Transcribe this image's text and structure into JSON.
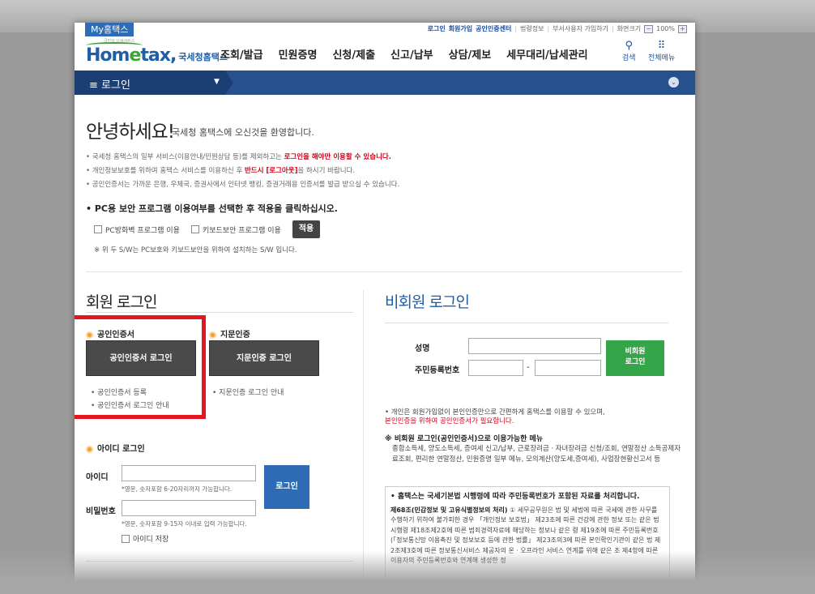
{
  "util": {
    "my_tab": "My홈택스",
    "links": [
      "로그인",
      "회원가입",
      "공인인증센터"
    ],
    "plain_links": [
      "법령정보",
      "부서사용자 가입하기",
      "화면크기"
    ],
    "zoom": "100%",
    "zoom_minus": "−",
    "zoom_plus": "+"
  },
  "header": {
    "logo_tiny": "국민의 납세서비스",
    "logo_ho": "Hom",
    "logo_e": "e",
    "logo_tax": "tax",
    "logo_comma": ",",
    "logo_sub": "국세청홈택스",
    "menu": [
      "조회/발급",
      "민원증명",
      "신청/제출",
      "신고/납부",
      "상담/제보",
      "세무대리/납세관리"
    ],
    "search_label": "검색",
    "allmenu_label": "전체메뉴"
  },
  "bar": {
    "label": "≡ 로그인",
    "caret": "▼",
    "circle": "⌄"
  },
  "greeting": {
    "title": "안녕하세요!",
    "sub": "국세청 홈택스에 오신것을 환영합니다.",
    "note1_a": "• 국세청 홈택스의 일부 서비스(이용안내/민원상담 등)를 제외하고는 ",
    "note1_b": "로그인을 해야만 이용할 수 있습니다.",
    "note2_a": "• 개인정보보호를 위하여 홈택스 서비스를 이용하신 후 ",
    "note2_b": "반드시 [로그아웃]",
    "note2_c": "을 하시기 바랍니다.",
    "note3": "• 공인인증서는 가까운 은행, 우체국, 증권사에서 인터넷 뱅킹, 증권거래용 인증서를 발급 받으실 수 있습니다."
  },
  "security": {
    "title": "• PC용 보안 프로그램 이용여부를 선택한 후 적용을 클릭하십시오.",
    "opt1": "PC방화벽 프로그램 이용",
    "opt2": "키보드보안 프로그램 이용",
    "apply": "적용",
    "note": "※ 위 두 S/W는 PC보호와 키보드보안을 위하여 설치하는 S/W 입니다."
  },
  "member": {
    "title": "회원 로그인",
    "cert_label": "공인인증서",
    "cert_button": "공인인증서 로그인",
    "cert_link1": "• 공인인증서 등록",
    "cert_link2": "• 공인인증서 로그인 안내",
    "finger_label": "지문인증",
    "finger_button": "지문인증 로그인",
    "finger_link": "• 지문인증 로그인 안내",
    "id_title": "아이디 로그인",
    "id_label": "아이디",
    "id_hint": "*영문, 숫자포함 6-20자리까지 가능합니다.",
    "pw_label": "비밀번호",
    "pw_hint": "*영문, 숫자포함 9-15자 이내로 입력 가능합니다.",
    "save_id": "아이디 저장",
    "login_button": "로그인"
  },
  "nonmember": {
    "title": "비회원 로그인",
    "name_label": "성명",
    "rrn_label": "주민등록번호",
    "rrn_sep": "-",
    "button_line1": "비회원",
    "button_line2": "로그인",
    "note_a": "• 개인은 회원가입없이 본인인증만으로 간편하게 홈택스를 이용할 수 있으며,",
    "note_b": "본인인증을 위하여 공인인증서가 필요합니다.",
    "menu_title": "※ 비회원 로그인(공인인증서)으로 이용가능한 메뉴",
    "menu_text": "종합소득세, 양도소득세, 증여세 신고/납부, 근로장려금ㆍ자녀장려금 신청/조회, 연말정산 소득공제자료조회, 편리한 연말정산, 민원증명 일부 메뉴, 모의계산(양도세,증여세), 사업장현황신고서 등",
    "legal_title": "• 홈택스는 국세기본법 시행령에 따라 주민등록번호가 포함된 자료를 처리합니다.",
    "legal_bold": "제68조(민감정보 및 고유식별정보의 처리)",
    "legal_text": " ① 세무공무원은 법 및 세법에 따른 국세에 관한 사무를 수행하기 위하여 불가피한 경우 「개인정보 보호법」 제23조에 따른 건강에 관한 정보 또는 같은 법 시행령 제18조제2호에 따른 범죄경력자료에 해당하는 정보나 같은 령 제19조에 따른 주민등록번호(「정보통신망 이용촉진 및 정보보호 등에 관한 법률」 제23조의3에 따른 본인확인기관이 같은 법 제2조제3호에 따른 정보통신서비스 제공자의 온ㆍ오프라인 서비스 연계를 위해 같은 조 제4항에 따른 이용자의 주민등록번호와 연계해 생성한 정"
  }
}
